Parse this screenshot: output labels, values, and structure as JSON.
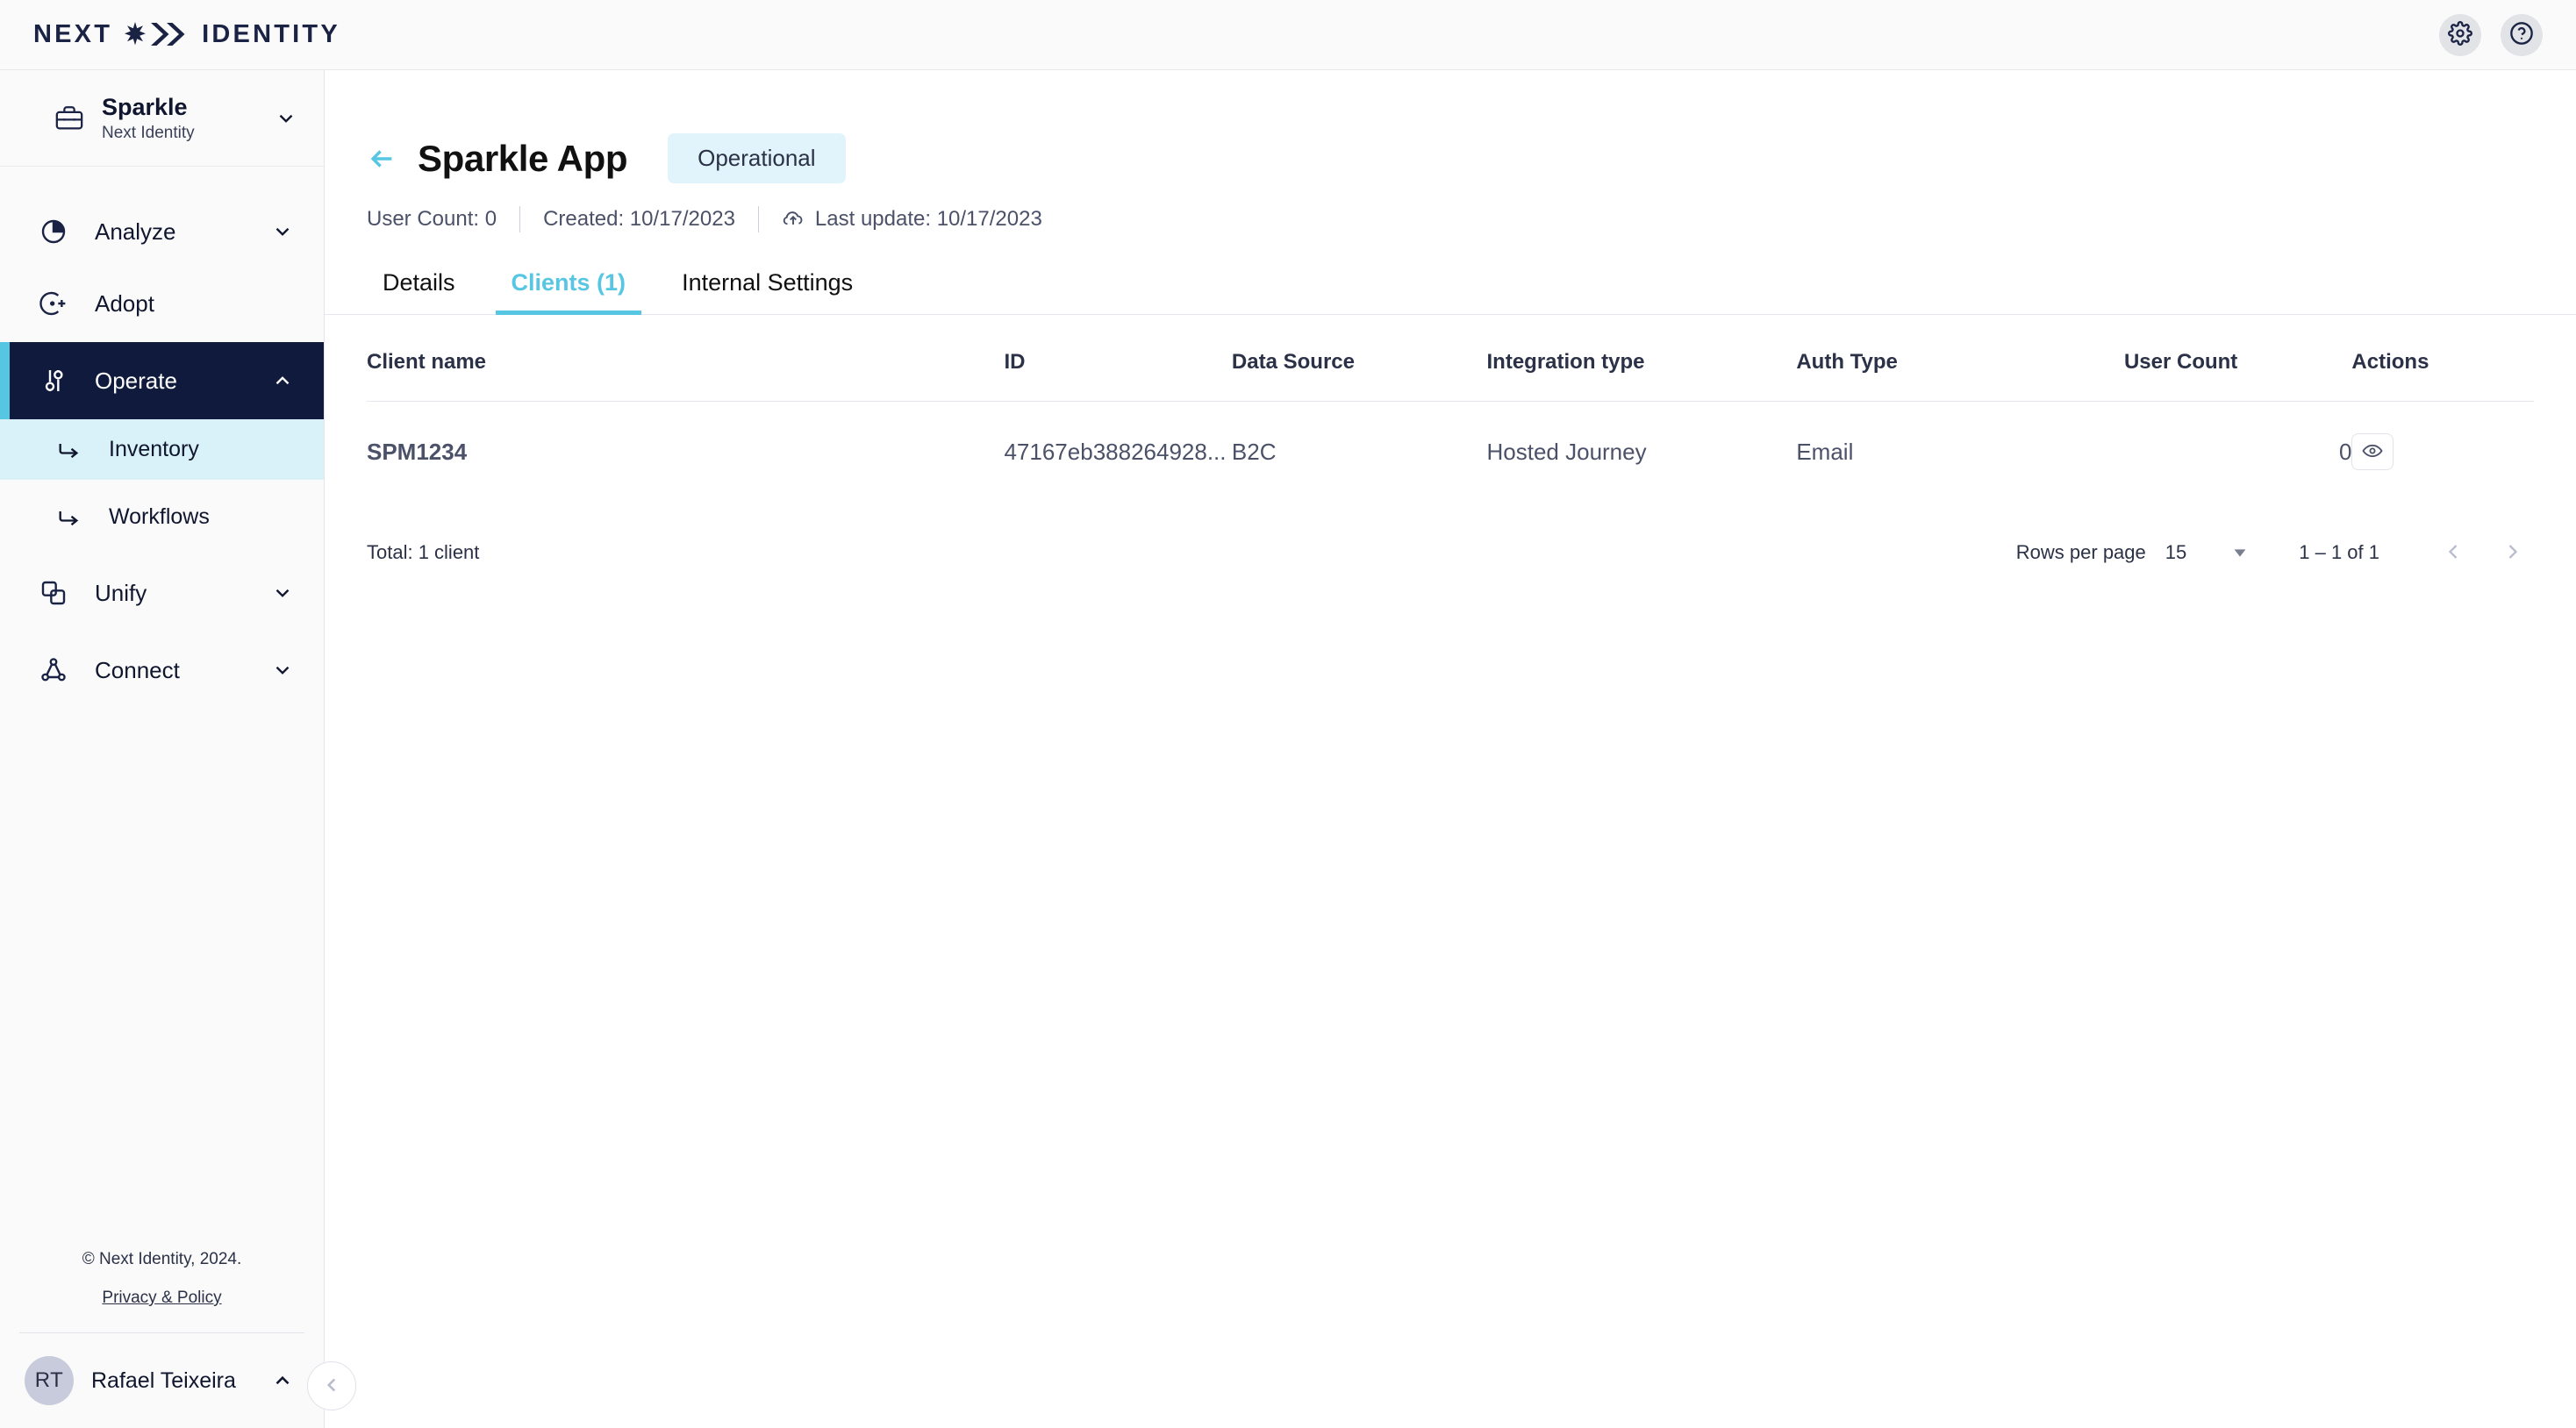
{
  "brand": {
    "word_left": "NEXT",
    "word_right": "IDENTITY"
  },
  "topbar": {
    "settings_icon": "gear-icon",
    "help_icon": "help-circle-icon"
  },
  "sidebar": {
    "tenant": {
      "name": "Sparkle",
      "subtitle": "Next Identity",
      "icon": "briefcase-icon"
    },
    "items": [
      {
        "label": "Analyze",
        "icon": "pie-chart-icon",
        "expandable": true,
        "expanded": false,
        "active": false
      },
      {
        "label": "Adopt",
        "icon": "user-add-icon",
        "expandable": false,
        "expanded": false,
        "active": false
      },
      {
        "label": "Operate",
        "icon": "sliders-icon",
        "expandable": true,
        "expanded": true,
        "active": true
      },
      {
        "label": "Unify",
        "icon": "layers-icon",
        "expandable": true,
        "expanded": false,
        "active": false
      },
      {
        "label": "Connect",
        "icon": "network-icon",
        "expandable": true,
        "expanded": false,
        "active": false
      }
    ],
    "operate_children": [
      {
        "label": "Inventory",
        "icon": "arrow-turn-right-icon",
        "selected": true
      },
      {
        "label": "Workflows",
        "icon": "arrow-turn-right-icon",
        "selected": false
      }
    ],
    "footer": {
      "copyright": "© Next Identity, 2024.",
      "privacy_label": "Privacy & Policy"
    },
    "user": {
      "initials": "RT",
      "name": "Rafael Teixeira"
    },
    "collapse_icon": "chevron-left-icon"
  },
  "page": {
    "back_icon": "arrow-left-icon",
    "title": "Sparkle App",
    "status": "Operational",
    "meta": {
      "user_count": "User Count: 0",
      "created": "Created: 10/17/2023",
      "last_update": "Last update: 10/17/2023",
      "last_update_icon": "cloud-upload-icon"
    },
    "tabs": [
      {
        "label": "Details",
        "active": false
      },
      {
        "label": "Clients (1)",
        "active": true
      },
      {
        "label": "Internal Settings",
        "active": false
      }
    ]
  },
  "table": {
    "columns": [
      "Client name",
      "ID",
      "Data Source",
      "Integration type",
      "Auth Type",
      "User Count",
      "Actions"
    ],
    "rows": [
      {
        "client_name": "SPM1234",
        "id": "47167eb388264928...",
        "data_source": "B2C",
        "integration_type": "Hosted Journey",
        "auth_type": "Email",
        "user_count": "0",
        "action_icon": "eye-icon"
      }
    ]
  },
  "footer": {
    "total": "Total: 1 client",
    "rows_per_page_label": "Rows per page",
    "rows_per_page_value": "15",
    "range": "1 – 1 of 1",
    "prev_icon": "chevron-left-icon",
    "next_icon": "chevron-right-icon"
  },
  "colors": {
    "accent_cyan": "#56c6e3",
    "navy": "#101a3d",
    "badge_bg": "#e2f4fb",
    "selected_bg": "#d9f1f8"
  }
}
